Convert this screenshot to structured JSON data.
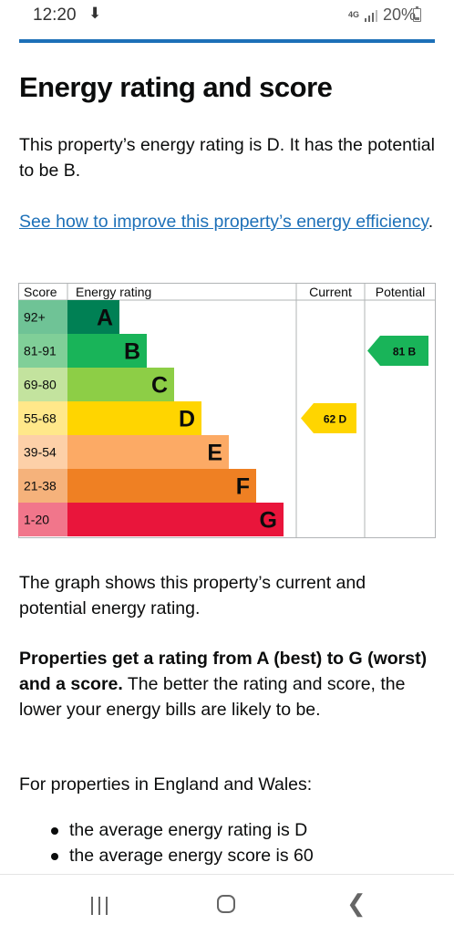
{
  "status_bar": {
    "time": "12:20",
    "download_glyph": "⬇",
    "network": "4G",
    "battery": "20%"
  },
  "page": {
    "title": "Energy rating and score",
    "intro": "This property’s energy rating is D. It has the potential to be B.",
    "link": "See how to improve this property’s energy efficiency",
    "link_suffix": ".",
    "graph_note": "The graph shows this property’s current and potential energy rating.",
    "rating_bold": "Properties get a rating from A (best) to G (worst) and a score.",
    "rating_rest": " The better the rating and score, the lower your energy bills are likely to be.",
    "england_wales": "For properties in England and Wales:",
    "bullets": [
      "the average energy rating is D",
      "the average energy score is 60"
    ]
  },
  "chart_data": {
    "type": "bar",
    "headers": {
      "score": "Score",
      "rating": "Energy rating",
      "current": "Current",
      "potential": "Potential"
    },
    "bands": [
      {
        "score": "92+",
        "letter": "A",
        "bar_color": "#008054",
        "score_bg": "#6fc396"
      },
      {
        "score": "81-91",
        "letter": "B",
        "bar_color": "#19b459",
        "score_bg": "#80cf98"
      },
      {
        "score": "69-80",
        "letter": "C",
        "bar_color": "#8dce46",
        "score_bg": "#c3e39e"
      },
      {
        "score": "55-68",
        "letter": "D",
        "bar_color": "#ffd500",
        "score_bg": "#ffe88a"
      },
      {
        "score": "39-54",
        "letter": "E",
        "bar_color": "#fcaa65",
        "score_bg": "#fdd0a8"
      },
      {
        "score": "21-38",
        "letter": "F",
        "bar_color": "#ef8023",
        "score_bg": "#f5b27b"
      },
      {
        "score": "1-20",
        "letter": "G",
        "bar_color": "#e9153b",
        "score_bg": "#f1768b"
      }
    ],
    "current": {
      "value": 62,
      "band": "D",
      "label": "62 D",
      "color": "#ffd500"
    },
    "potential": {
      "value": 81,
      "band": "B",
      "label": "81 B",
      "color": "#19b459"
    }
  },
  "navbar": {
    "recents": "recents-icon",
    "home": "home-icon",
    "back": "back-icon"
  }
}
